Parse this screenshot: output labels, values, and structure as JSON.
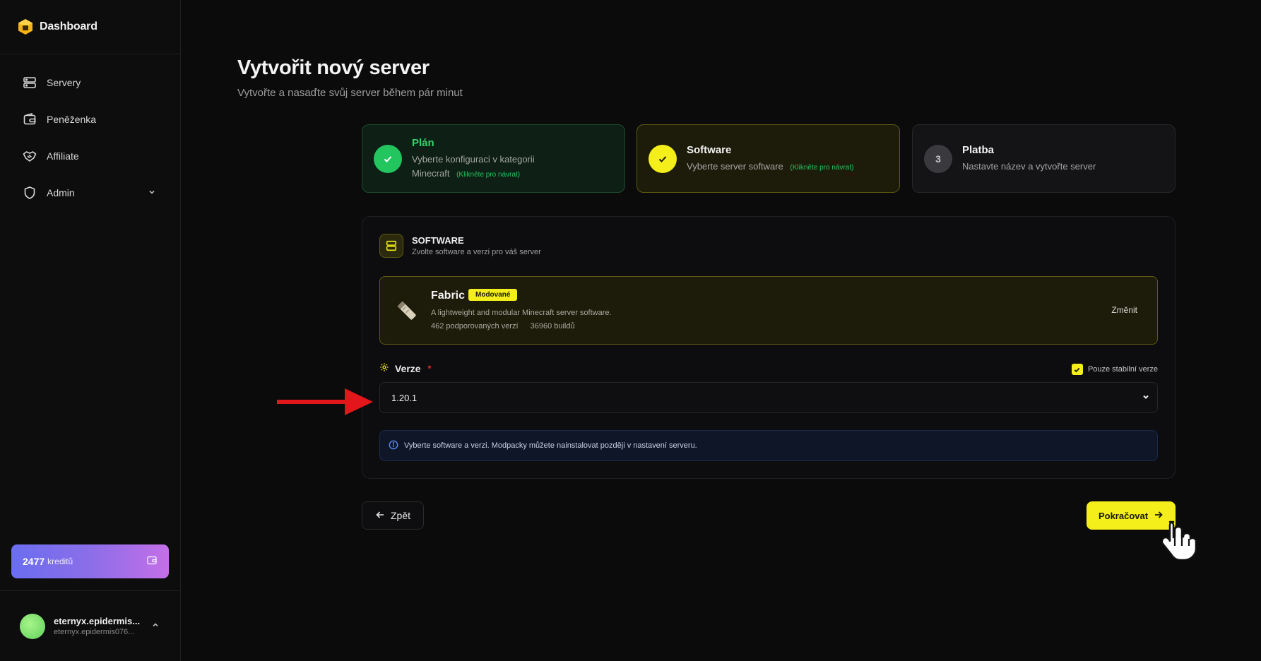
{
  "brand": {
    "title": "Dashboard"
  },
  "sidebar": {
    "items": [
      {
        "label": "Servery",
        "icon": "server-icon"
      },
      {
        "label": "Peněženka",
        "icon": "wallet-icon"
      },
      {
        "label": "Affiliate",
        "icon": "handshake-icon"
      },
      {
        "label": "Admin",
        "icon": "shield-icon"
      }
    ],
    "credits": {
      "amount": "2477",
      "label": "kreditů"
    },
    "user": {
      "name": "eternyx.epidermis...",
      "email": "eternyx.epidermis076..."
    }
  },
  "page": {
    "title": "Vytvořit nový server",
    "subtitle": "Vytvořte a nasaďte svůj server během pár minut"
  },
  "steps": [
    {
      "title": "Plán",
      "desc_line1": "Vyberte konfiguraci v kategorii",
      "desc_line2": "Minecraft",
      "hint": "(Klikněte pro návrat)",
      "state": "done"
    },
    {
      "title": "Software",
      "desc": "Vyberte server software",
      "hint": "(Klikněte pro návrat)",
      "state": "active"
    },
    {
      "number": "3",
      "title": "Platba",
      "desc": "Nastavte název a vytvořte server",
      "state": "pending"
    }
  ],
  "software_section": {
    "title": "SOFTWARE",
    "subtitle": "Zvolte software a verzi pro váš server",
    "selected": {
      "name": "Fabric",
      "tag": "Modované",
      "description": "A lightweight and modular Minecraft server software.",
      "versions_count": "462 podporovaných verzí",
      "builds_count": "36960 buildů",
      "change_label": "Změnit"
    },
    "version_label": "Verze",
    "required_mark": "*",
    "stable_only_label": "Pouze stabilní verze",
    "stable_only_checked": true,
    "version_value": "1.20.1",
    "info_text": "Vyberte software a verzi. Modpacky můžete nainstalovat později v nastavení serveru."
  },
  "actions": {
    "back_label": "Zpět",
    "next_label": "Pokračovat"
  },
  "colors": {
    "accent": "#f4ee1a",
    "success": "#22c55e",
    "background": "#0b0b0c"
  }
}
